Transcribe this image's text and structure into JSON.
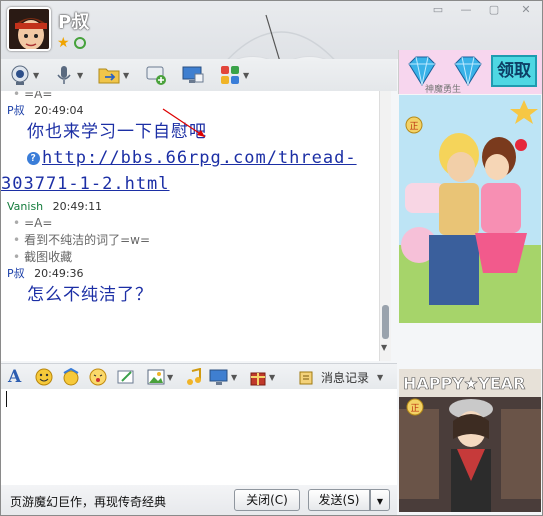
{
  "header": {
    "nickname": "P叔"
  },
  "promo": {
    "gem_label": "神魔勇生",
    "claim_label": "领取"
  },
  "chat": {
    "partial_line": "=A=",
    "messages": [
      {
        "sender": "P叔",
        "time": "20:49:04",
        "lines": [
          "你也来学习一下自慰吧"
        ],
        "link_lines": [
          "http://bbs.66rpg.com/thread-",
          "303771-1-2.html"
        ]
      },
      {
        "sender": "Vanish",
        "time": "20:49:11",
        "plain_lines": [
          "=A=",
          "看到不纯洁的词了=w=",
          "截图收藏"
        ]
      },
      {
        "sender": "P叔",
        "time": "20:49:36",
        "lines": [
          "怎么不纯洁了？"
        ]
      }
    ]
  },
  "input_toolbar": {
    "history_label": "消息记录"
  },
  "footer": {
    "ad_text": "页游魔幻巨作，再现传奇经典",
    "close_label": "关闭(C)",
    "send_label": "发送(S)"
  },
  "colors": {
    "accent": "#1c2fa5",
    "sender_self": "#1b3fa8",
    "sender_other": "#147c3c",
    "claim_bg": "#4fd7e3"
  }
}
